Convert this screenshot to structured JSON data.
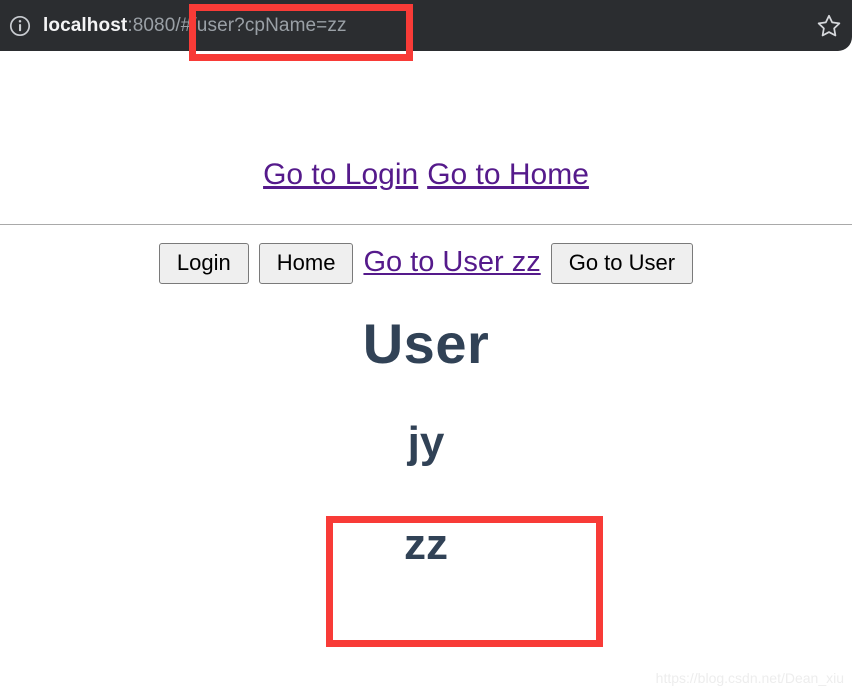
{
  "browser": {
    "info_icon": "info-circle-icon",
    "star_icon": "bookmark-star-icon",
    "url": {
      "host": "localhost",
      "port_path": ":8080/",
      "hash_query": "#/user?cpName=zz",
      "full": "localhost:8080/#/user?cpName=zz"
    }
  },
  "annotations": {
    "color": "#f83b37",
    "url_highlight_target": "#/user?cpName=zz",
    "value_highlight_target": "zz"
  },
  "page": {
    "top_nav": [
      {
        "label": "Go to Login",
        "name": "nav-link-login"
      },
      {
        "label": "Go to Home",
        "name": "nav-link-home"
      }
    ],
    "button_row": [
      {
        "label": "Login",
        "type": "button",
        "name": "login-button"
      },
      {
        "label": "Home",
        "type": "button",
        "name": "home-button"
      },
      {
        "label": "Go to User zz",
        "type": "link",
        "name": "go-to-user-zz-link"
      },
      {
        "label": "Go to User",
        "type": "button",
        "name": "go-to-user-button"
      }
    ],
    "heading": "User",
    "value_primary": "jy",
    "value_secondary": "zz",
    "link_color": "#551a8b",
    "heading_color": "#314256"
  },
  "watermark": "https://blog.csdn.net/Dean_xiu"
}
